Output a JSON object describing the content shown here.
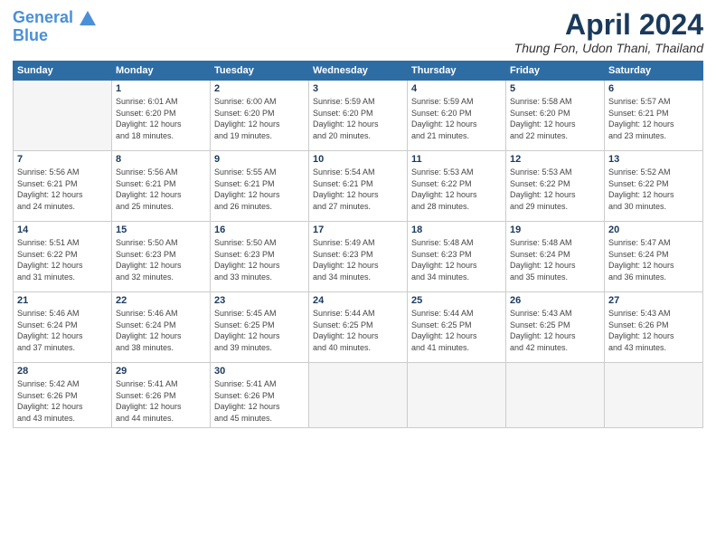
{
  "header": {
    "logo_line1": "General",
    "logo_line2": "Blue",
    "month": "April 2024",
    "location": "Thung Fon, Udon Thani, Thailand"
  },
  "days_of_week": [
    "Sunday",
    "Monday",
    "Tuesday",
    "Wednesday",
    "Thursday",
    "Friday",
    "Saturday"
  ],
  "weeks": [
    [
      {
        "day": "",
        "empty": true
      },
      {
        "day": "1",
        "sunrise": "6:01 AM",
        "sunset": "6:20 PM",
        "daylight": "12 hours and 18 minutes."
      },
      {
        "day": "2",
        "sunrise": "6:00 AM",
        "sunset": "6:20 PM",
        "daylight": "12 hours and 19 minutes."
      },
      {
        "day": "3",
        "sunrise": "5:59 AM",
        "sunset": "6:20 PM",
        "daylight": "12 hours and 20 minutes."
      },
      {
        "day": "4",
        "sunrise": "5:59 AM",
        "sunset": "6:20 PM",
        "daylight": "12 hours and 21 minutes."
      },
      {
        "day": "5",
        "sunrise": "5:58 AM",
        "sunset": "6:20 PM",
        "daylight": "12 hours and 22 minutes."
      },
      {
        "day": "6",
        "sunrise": "5:57 AM",
        "sunset": "6:21 PM",
        "daylight": "12 hours and 23 minutes."
      }
    ],
    [
      {
        "day": "7",
        "sunrise": "5:56 AM",
        "sunset": "6:21 PM",
        "daylight": "12 hours and 24 minutes."
      },
      {
        "day": "8",
        "sunrise": "5:56 AM",
        "sunset": "6:21 PM",
        "daylight": "12 hours and 25 minutes."
      },
      {
        "day": "9",
        "sunrise": "5:55 AM",
        "sunset": "6:21 PM",
        "daylight": "12 hours and 26 minutes."
      },
      {
        "day": "10",
        "sunrise": "5:54 AM",
        "sunset": "6:21 PM",
        "daylight": "12 hours and 27 minutes."
      },
      {
        "day": "11",
        "sunrise": "5:53 AM",
        "sunset": "6:22 PM",
        "daylight": "12 hours and 28 minutes."
      },
      {
        "day": "12",
        "sunrise": "5:53 AM",
        "sunset": "6:22 PM",
        "daylight": "12 hours and 29 minutes."
      },
      {
        "day": "13",
        "sunrise": "5:52 AM",
        "sunset": "6:22 PM",
        "daylight": "12 hours and 30 minutes."
      }
    ],
    [
      {
        "day": "14",
        "sunrise": "5:51 AM",
        "sunset": "6:22 PM",
        "daylight": "12 hours and 31 minutes."
      },
      {
        "day": "15",
        "sunrise": "5:50 AM",
        "sunset": "6:23 PM",
        "daylight": "12 hours and 32 minutes."
      },
      {
        "day": "16",
        "sunrise": "5:50 AM",
        "sunset": "6:23 PM",
        "daylight": "12 hours and 33 minutes."
      },
      {
        "day": "17",
        "sunrise": "5:49 AM",
        "sunset": "6:23 PM",
        "daylight": "12 hours and 34 minutes."
      },
      {
        "day": "18",
        "sunrise": "5:48 AM",
        "sunset": "6:23 PM",
        "daylight": "12 hours and 34 minutes."
      },
      {
        "day": "19",
        "sunrise": "5:48 AM",
        "sunset": "6:24 PM",
        "daylight": "12 hours and 35 minutes."
      },
      {
        "day": "20",
        "sunrise": "5:47 AM",
        "sunset": "6:24 PM",
        "daylight": "12 hours and 36 minutes."
      }
    ],
    [
      {
        "day": "21",
        "sunrise": "5:46 AM",
        "sunset": "6:24 PM",
        "daylight": "12 hours and 37 minutes."
      },
      {
        "day": "22",
        "sunrise": "5:46 AM",
        "sunset": "6:24 PM",
        "daylight": "12 hours and 38 minutes."
      },
      {
        "day": "23",
        "sunrise": "5:45 AM",
        "sunset": "6:25 PM",
        "daylight": "12 hours and 39 minutes."
      },
      {
        "day": "24",
        "sunrise": "5:44 AM",
        "sunset": "6:25 PM",
        "daylight": "12 hours and 40 minutes."
      },
      {
        "day": "25",
        "sunrise": "5:44 AM",
        "sunset": "6:25 PM",
        "daylight": "12 hours and 41 minutes."
      },
      {
        "day": "26",
        "sunrise": "5:43 AM",
        "sunset": "6:25 PM",
        "daylight": "12 hours and 42 minutes."
      },
      {
        "day": "27",
        "sunrise": "5:43 AM",
        "sunset": "6:26 PM",
        "daylight": "12 hours and 43 minutes."
      }
    ],
    [
      {
        "day": "28",
        "sunrise": "5:42 AM",
        "sunset": "6:26 PM",
        "daylight": "12 hours and 43 minutes."
      },
      {
        "day": "29",
        "sunrise": "5:41 AM",
        "sunset": "6:26 PM",
        "daylight": "12 hours and 44 minutes."
      },
      {
        "day": "30",
        "sunrise": "5:41 AM",
        "sunset": "6:26 PM",
        "daylight": "12 hours and 45 minutes."
      },
      {
        "day": "",
        "empty": true
      },
      {
        "day": "",
        "empty": true
      },
      {
        "day": "",
        "empty": true
      },
      {
        "day": "",
        "empty": true
      }
    ]
  ]
}
